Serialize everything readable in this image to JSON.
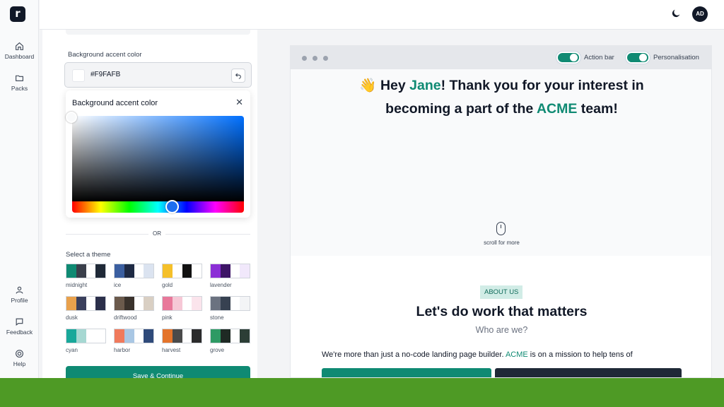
{
  "app": {
    "logo_letter": "r"
  },
  "nav": {
    "dashboard": "Dashboard",
    "packs": "Packs",
    "profile": "Profile",
    "feedback": "Feedback",
    "help": "Help"
  },
  "topbar": {
    "avatar_initials": "AD"
  },
  "settings": {
    "bg_accent_label": "Background accent color",
    "bg_accent_value": "#F9FAFB",
    "picker_title": "Background accent color",
    "picker_close": "✕",
    "picker_hue_level": 0.6,
    "or_text": "OR",
    "theme_label": "Select a theme",
    "themes": [
      {
        "name": "midnight",
        "colors": [
          "#0f8a73",
          "#3a3f4b",
          "#ffffff",
          "#1f2937"
        ]
      },
      {
        "name": "ice",
        "colors": [
          "#3b5fa0",
          "#1e2a44",
          "#ffffff",
          "#dbe3f0"
        ]
      },
      {
        "name": "gold",
        "colors": [
          "#f5c02a",
          "#ffffff",
          "#111111",
          "#ffffff"
        ]
      },
      {
        "name": "lavender",
        "colors": [
          "#8b2fd6",
          "#3d1566",
          "#ffffff",
          "#f1e8fb"
        ]
      },
      {
        "name": "dusk",
        "colors": [
          "#e9a14c",
          "#3a3f5c",
          "#ffffff",
          "#2b2f4a"
        ]
      },
      {
        "name": "driftwood",
        "colors": [
          "#6b5a4c",
          "#3a322c",
          "#ffffff",
          "#d9cfc3"
        ]
      },
      {
        "name": "pink",
        "colors": [
          "#e8789a",
          "#f6c8d6",
          "#ffffff",
          "#fbe4ec"
        ]
      },
      {
        "name": "stone",
        "colors": [
          "#6b7280",
          "#374151",
          "#ffffff",
          "#f3f4f6"
        ]
      },
      {
        "name": "cyan",
        "colors": [
          "#18a89a",
          "#a6d8d2",
          "#ffffff",
          "#ffffff"
        ]
      },
      {
        "name": "harbor",
        "colors": [
          "#f07a5c",
          "#a9c7e4",
          "#ffffff",
          "#2f4a7a"
        ]
      },
      {
        "name": "harvest",
        "colors": [
          "#e4742a",
          "#4a4a4a",
          "#ffffff",
          "#2b2b2b"
        ]
      },
      {
        "name": "grove",
        "colors": [
          "#2e9a64",
          "#1f2a24",
          "#ffffff",
          "#2c3e36"
        ]
      }
    ],
    "save_label": "Save & Continue"
  },
  "preview": {
    "toggle_action_bar": "Action bar",
    "toggle_personalisation": "Personalisation",
    "hero": {
      "emoji": "👋",
      "hey": "Hey ",
      "name": "Jane",
      "line1_rest": "! Thank you for your interest in",
      "line2_pre": "becoming a part of the ",
      "company": "ACME",
      "line2_post": " team!"
    },
    "scroll_text": "scroll for more",
    "about": {
      "badge": "ABOUT US",
      "title": "Let's do work that matters",
      "subtitle": "Who are we?",
      "body_pre": "We're more than just a no-code landing page builder. ",
      "body_company": "ACME",
      "body_post": " is on a mission to help tens of"
    }
  },
  "colors": {
    "accent": "#0f8a73",
    "footer": "#4e9a25"
  }
}
